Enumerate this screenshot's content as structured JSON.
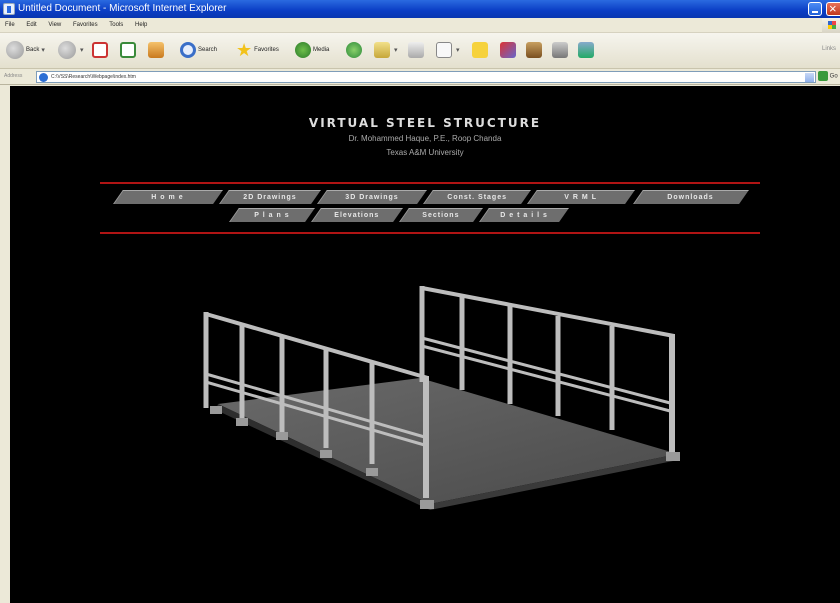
{
  "window": {
    "title": "Untitled Document - Microsoft Internet Explorer"
  },
  "menu": [
    "File",
    "Edit",
    "View",
    "Favorites",
    "Tools",
    "Help"
  ],
  "toolbar": {
    "back": "Back",
    "search": "Search",
    "favorites": "Favorites",
    "media": "Media",
    "links": "Links"
  },
  "address": {
    "label": "Address",
    "url": "C:\\VSS\\Research\\Webpage\\index.htm",
    "go": "Go"
  },
  "page": {
    "title": "VIRTUAL STEEL STRUCTURE",
    "authors": "Dr. Mohammed Haque, P.E., Roop Chanda",
    "university": "Texas A&M University",
    "nav_primary": [
      "H o m e",
      "2D Drawings",
      "3D Drawings",
      "Const. Stages",
      "V R M L",
      "Downloads"
    ],
    "nav_secondary": [
      "P l a n s",
      "Elevations",
      "Sections",
      "D e t a i l s"
    ]
  },
  "colors": {
    "background": "#000000",
    "accent_line": "#b01414",
    "tab": "#6e6e6e"
  }
}
